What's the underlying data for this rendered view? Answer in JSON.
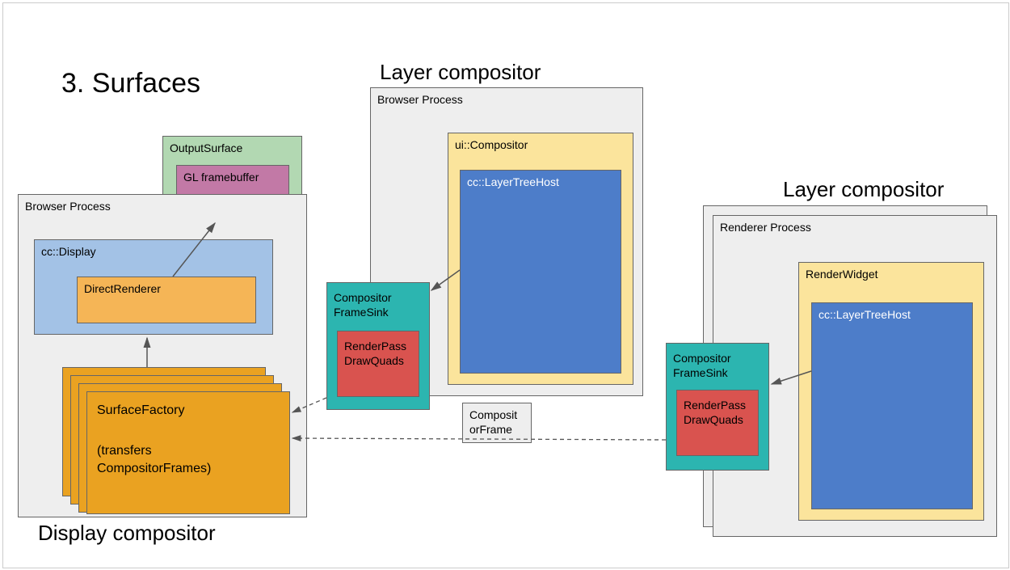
{
  "title": "3. Surfaces",
  "headings": {
    "layerCompositor1": "Layer compositor",
    "layerCompositor2": "Layer compositor",
    "displayCompositor": "Display compositor"
  },
  "left": {
    "panelLabel": "Browser Process",
    "outputSurface": "OutputSurface",
    "glFramebuffer": "GL framebuffer",
    "ccDisplay": "cc::Display",
    "directRenderer": "DirectRenderer",
    "surfaceFactory1": "SurfaceFactory",
    "surfaceFactory2": "(transfers",
    "surfaceFactory3": "CompositorFrames)"
  },
  "middle": {
    "panelLabel": "Browser Process",
    "uiCompositor": "ui::Compositor",
    "layerTreeHost": "cc::LayerTreeHost",
    "cfsLabel1": "Compositor",
    "cfsLabel2": "FrameSink",
    "rp1": "RenderPass",
    "rp2": "DrawQuads",
    "compositorFrame1": "Composit",
    "compositorFrame2": "orFrame"
  },
  "right": {
    "panelLabel": "Renderer Process",
    "renderWidget": "RenderWidget",
    "layerTreeHost": "cc::LayerTreeHost",
    "cfsLabel1": "Compositor",
    "cfsLabel2": "FrameSink",
    "rp1": "RenderPass",
    "rp2": "DrawQuads"
  },
  "colors": {
    "panel": "#eeeeee",
    "green": "#b2d8b2",
    "purple": "#c279a6",
    "blue": "#a3c2e6",
    "orange": "#f5b556",
    "deepOrange": "#eaa221",
    "teal": "#2cb5b0",
    "red": "#d9534f",
    "yellow": "#fbe49c",
    "deepBlue": "#4d7dc9"
  }
}
